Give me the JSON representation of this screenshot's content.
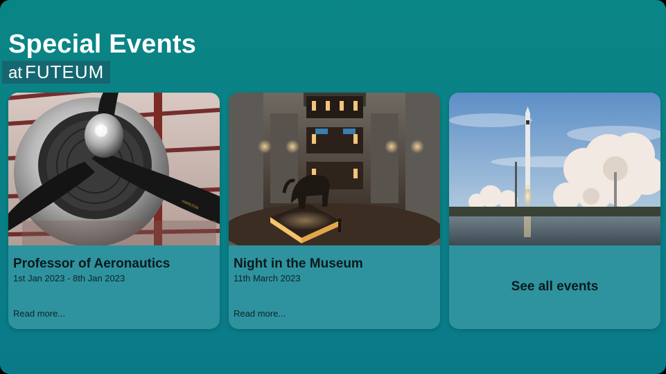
{
  "header": {
    "title": "Special Events",
    "subtitle_prefix": "at",
    "subtitle_brand": "FUTEUM"
  },
  "events": [
    {
      "title": "Professor of Aeronautics",
      "date": "1st Jan 2023 - 8th Jan 2023",
      "link_label": "Read more...",
      "image": "propeller-aircraft-photo"
    },
    {
      "title": "Night in the Museum",
      "date": "11th March 2023",
      "link_label": "Read more...",
      "image": "museum-hall-elephant-photo"
    }
  ],
  "see_all": {
    "label": "See all events",
    "image": "rocket-launch-photo"
  },
  "colors": {
    "background": "#0a8585",
    "card": "#2e939f",
    "text_dark": "#0b1a1c",
    "text_light": "#ffffff"
  }
}
